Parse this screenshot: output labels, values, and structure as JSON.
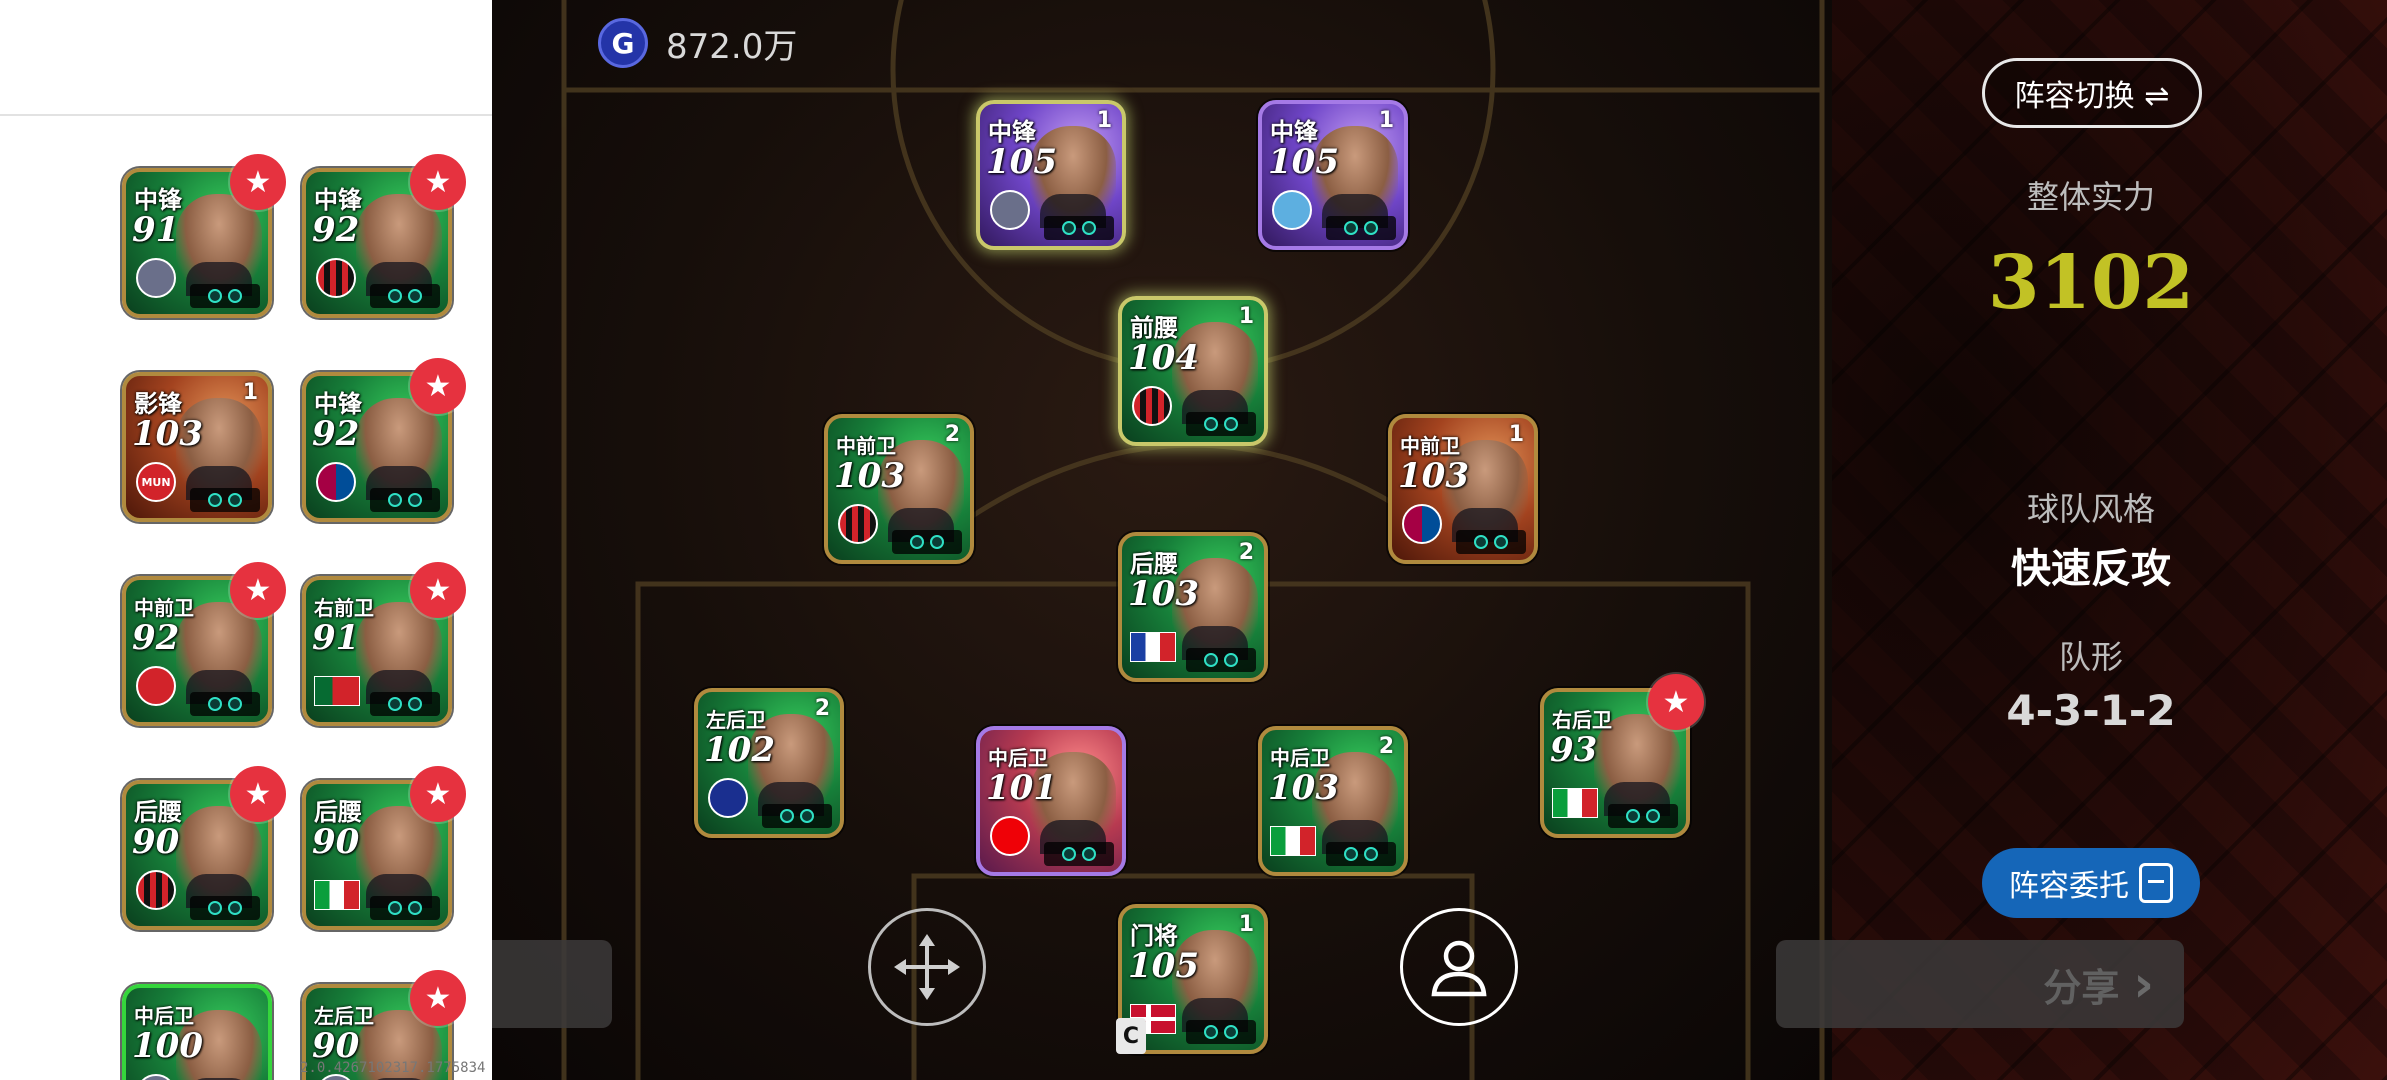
{
  "currency": {
    "icon": "g-coin-icon",
    "symbol": "G",
    "amount": "872.0万"
  },
  "version_text": "2.0.4267102317.1775834",
  "bench": [
    {
      "position": "中锋",
      "rating": "91",
      "level": "",
      "club": "club-gen",
      "club_label": "",
      "starred": true,
      "style": "green"
    },
    {
      "position": "中锋",
      "rating": "92",
      "level": "",
      "club": "club-acm",
      "club_label": "",
      "starred": true,
      "style": "green"
    },
    {
      "position": "影锋",
      "rating": "103",
      "level": "1",
      "club": "club-mun",
      "club_label": "MUN",
      "starred": false,
      "style": "red"
    },
    {
      "position": "中锋",
      "rating": "92",
      "level": "",
      "club": "club-fcb",
      "club_label": "",
      "starred": true,
      "style": "green"
    },
    {
      "position": "中前卫",
      "rating": "92",
      "level": "",
      "club": "club-mun",
      "club_label": "",
      "starred": true,
      "style": "green"
    },
    {
      "position": "右前卫",
      "rating": "91",
      "level": "",
      "club": "flag-pt",
      "club_label": "",
      "starred": true,
      "style": "green"
    },
    {
      "position": "后腰",
      "rating": "90",
      "level": "",
      "club": "club-acm",
      "club_label": "",
      "starred": true,
      "style": "green"
    },
    {
      "position": "后腰",
      "rating": "90",
      "level": "",
      "club": "flag-it",
      "club_label": "",
      "starred": true,
      "style": "green"
    },
    {
      "position": "中后卫",
      "rating": "100",
      "level": "",
      "club": "club-gen",
      "club_label": "",
      "starred": false,
      "style": "green lightgreen"
    },
    {
      "position": "左后卫",
      "rating": "90",
      "level": "",
      "club": "club-gen",
      "club_label": "",
      "starred": true,
      "style": "green"
    }
  ],
  "lineup": [
    {
      "key": "st-left",
      "position": "中锋",
      "rating": "105",
      "level": "1",
      "club": "club-gen",
      "starred": false,
      "style": "purple glow"
    },
    {
      "key": "st-right",
      "position": "中锋",
      "rating": "105",
      "level": "1",
      "club": "club-mci",
      "starred": false,
      "style": "purple"
    },
    {
      "key": "cam",
      "position": "前腰",
      "rating": "104",
      "level": "1",
      "club": "club-acm",
      "starred": false,
      "style": "green glow"
    },
    {
      "key": "lcm",
      "position": "中前卫",
      "rating": "103",
      "level": "2",
      "club": "club-acm",
      "starred": false,
      "style": "green"
    },
    {
      "key": "rcm",
      "position": "中前卫",
      "rating": "103",
      "level": "1",
      "club": "club-fcb",
      "starred": false,
      "style": "red"
    },
    {
      "key": "cdm",
      "position": "后腰",
      "rating": "103",
      "level": "2",
      "club": "flag-fr",
      "starred": false,
      "style": "green"
    },
    {
      "key": "lb",
      "position": "左后卫",
      "rating": "102",
      "level": "2",
      "club": "club-int",
      "starred": false,
      "style": "green"
    },
    {
      "key": "lcb",
      "position": "中后卫",
      "rating": "101",
      "level": "",
      "club": "club-ars",
      "starred": false,
      "style": "redpurple"
    },
    {
      "key": "rcb",
      "position": "中后卫",
      "rating": "103",
      "level": "2",
      "club": "flag-it",
      "starred": false,
      "style": "green"
    },
    {
      "key": "rb",
      "position": "右后卫",
      "rating": "93",
      "level": "",
      "club": "flag-it",
      "starred": true,
      "style": "green"
    },
    {
      "key": "gk",
      "position": "门将",
      "rating": "105",
      "level": "1",
      "club": "flag-dk",
      "starred": false,
      "style": "green"
    }
  ],
  "right_panel": {
    "switch_label": "阵容切换 ⇌",
    "strength_label": "整体实力",
    "strength_value": "3102",
    "style_label": "球队风格",
    "style_value": "快速反攻",
    "formation_label": "队形",
    "formation_value": "4-3-1-2",
    "delegate_label": "阵容委托",
    "share_label": "分享"
  },
  "gk_tag": "C",
  "icons": {
    "move": "move-arrows-icon",
    "player": "player-profile-icon",
    "star": "star-badge-icon",
    "share_chevron": "chevron-right-icon",
    "delegate": "clipboard-icon"
  }
}
